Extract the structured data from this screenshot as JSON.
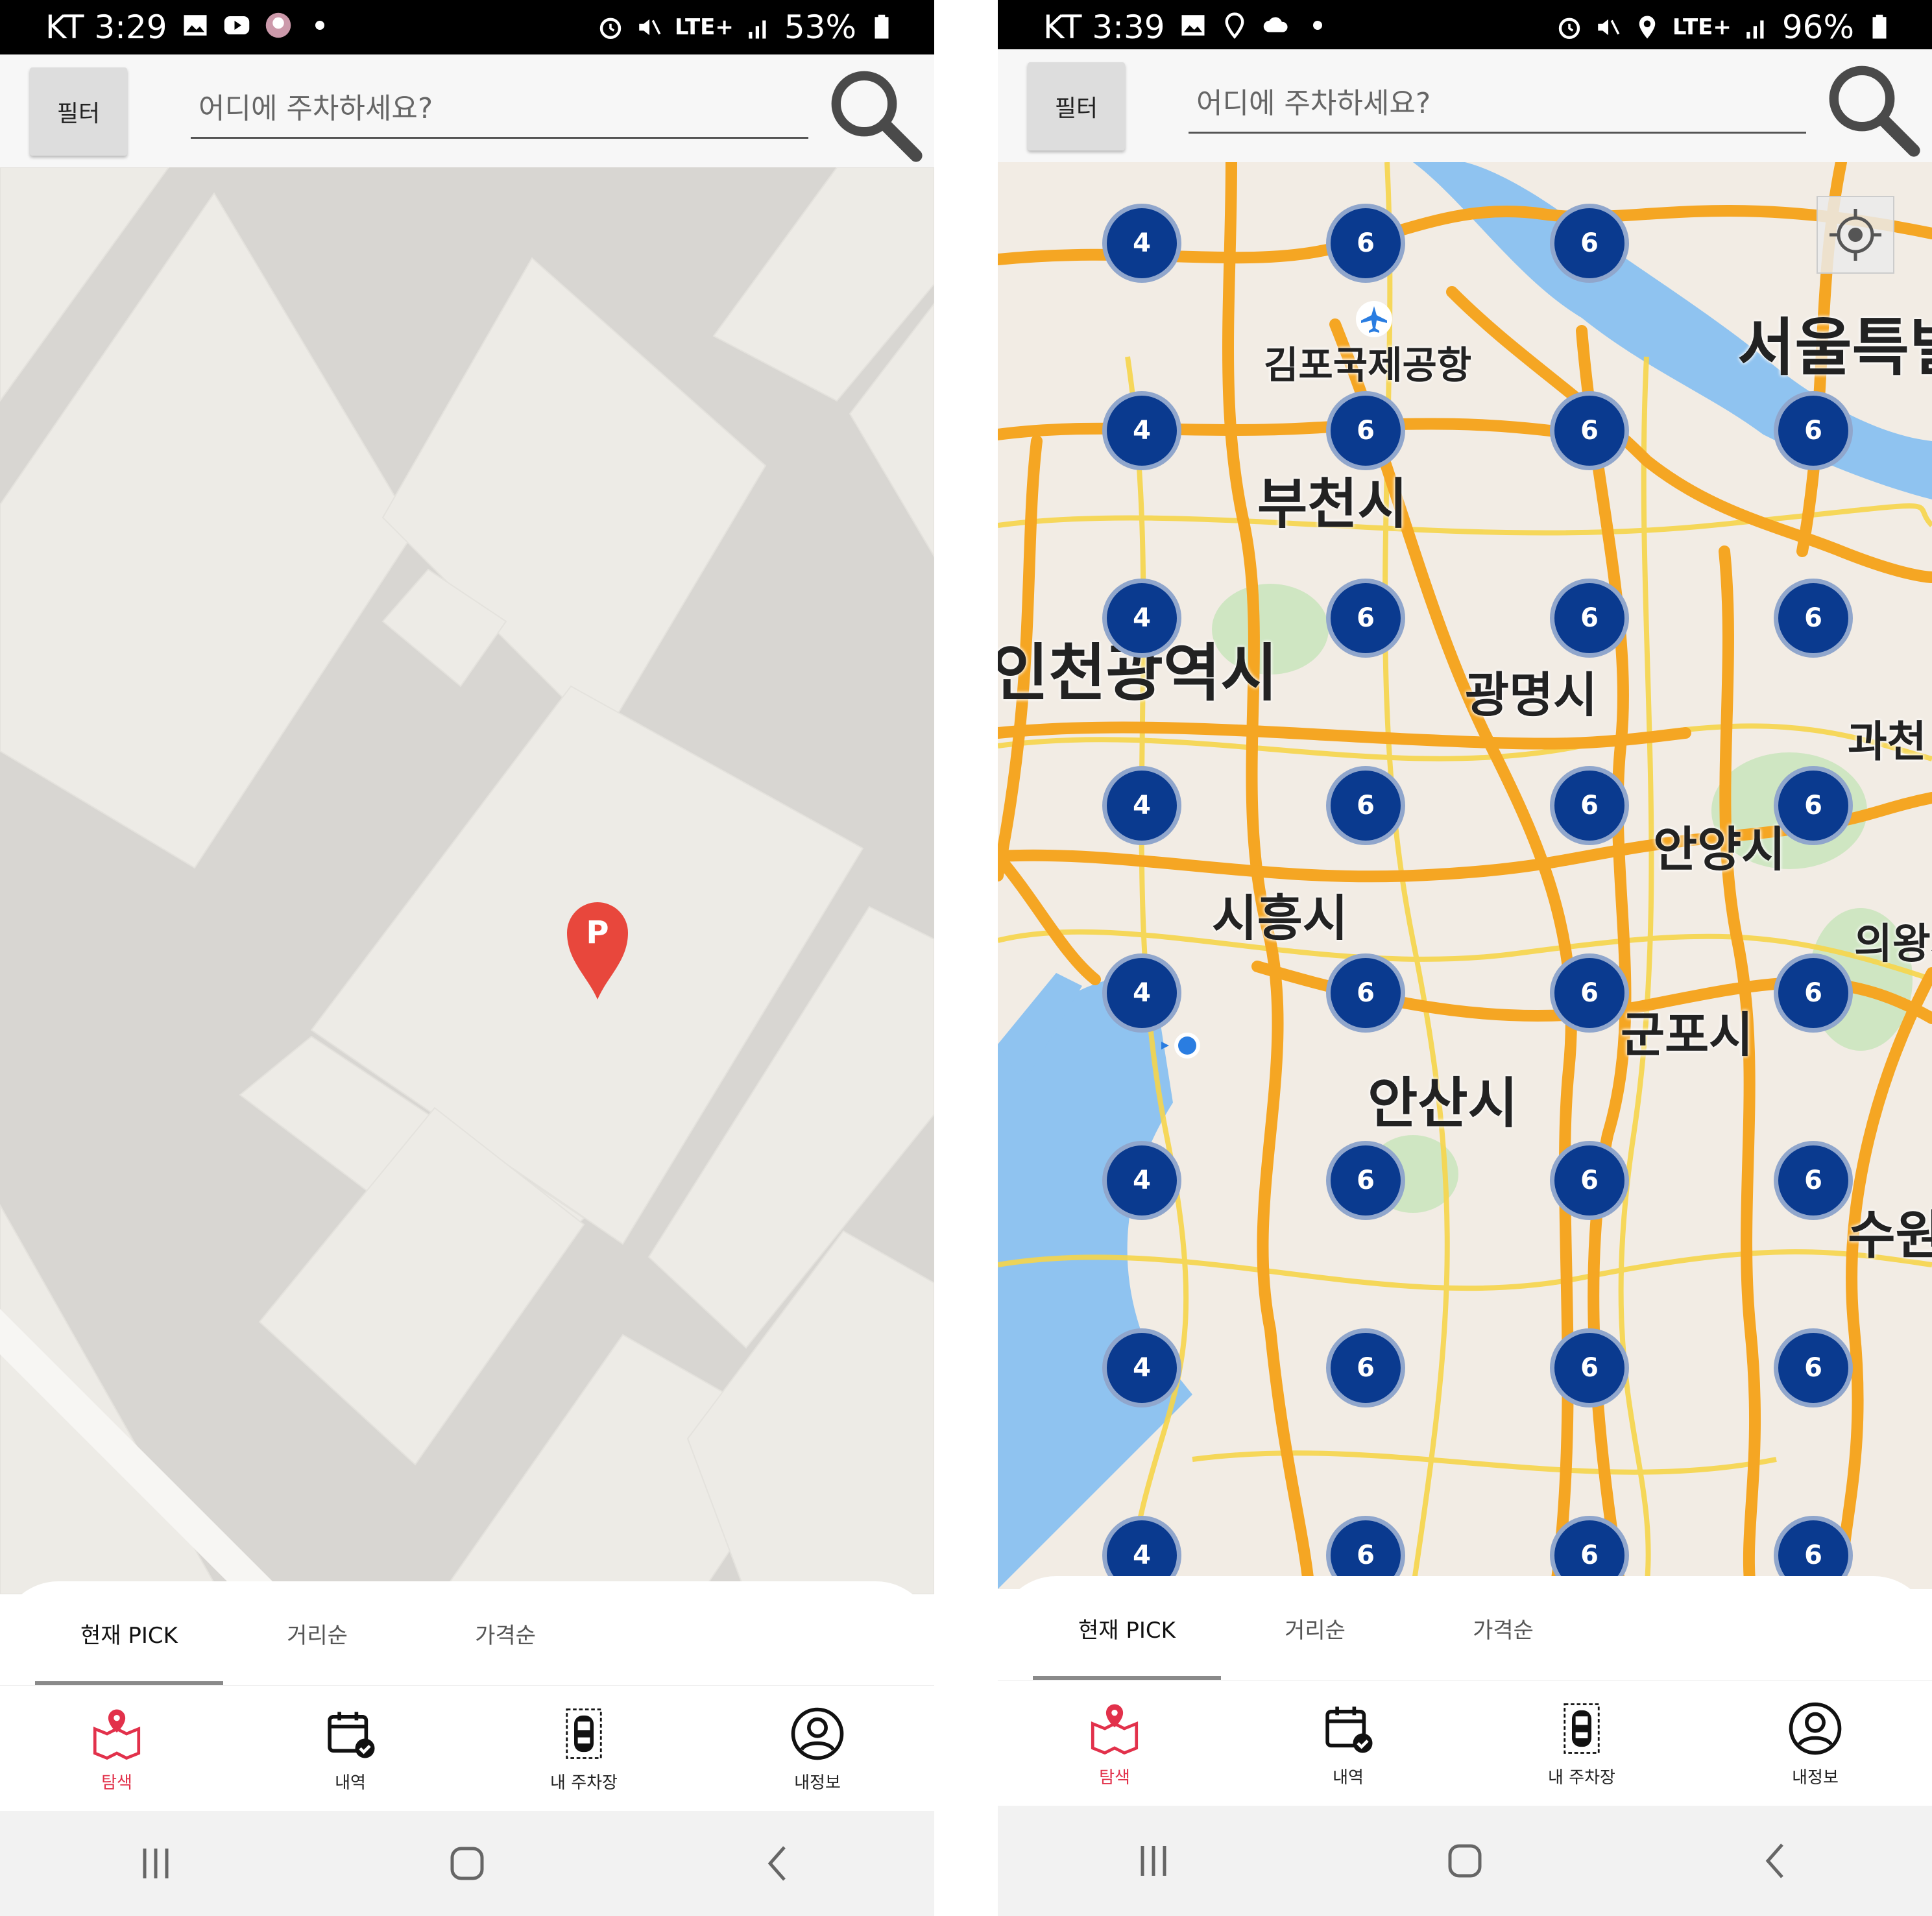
{
  "left": {
    "status": {
      "carrier_time": "KT 3:29",
      "battery": "53%",
      "network": "LTE+",
      "icons": [
        "gallery-icon",
        "youtube-icon",
        "avatar-icon",
        "dot-icon",
        "alarm-icon",
        "mute-icon",
        "hd-icon",
        "lte-icon",
        "signal-icon",
        "battery-icon"
      ]
    },
    "header": {
      "filter_label": "필터",
      "search_placeholder": "어디에 주차하세요?",
      "search_icon": "search-icon"
    },
    "map": {
      "marker_letter": "P",
      "marker_color": "#e8473c"
    },
    "tabs": [
      {
        "label": "현재 PICK",
        "active": true
      },
      {
        "label": "거리순",
        "active": false
      },
      {
        "label": "가격순",
        "active": false
      }
    ],
    "nav": [
      {
        "label": "탐색",
        "icon": "map-pin-icon",
        "active": true
      },
      {
        "label": "내역",
        "icon": "calendar-check-icon",
        "active": false
      },
      {
        "label": "내 주차장",
        "icon": "car-icon",
        "active": false
      },
      {
        "label": "내정보",
        "icon": "user-icon",
        "active": false
      }
    ]
  },
  "right": {
    "status": {
      "carrier_time": "KT 3:39",
      "battery": "96%",
      "network": "LTE+",
      "icons": [
        "gallery-icon",
        "location-icon",
        "cloud-icon",
        "dot-icon",
        "alarm-icon",
        "mute-icon",
        "location-icon",
        "hd-icon",
        "lte-icon",
        "signal-icon",
        "battery-icon"
      ]
    },
    "header": {
      "filter_label": "필터",
      "search_placeholder": "어디에 주차하세요?",
      "search_icon": "search-icon"
    },
    "map": {
      "places": {
        "airport": "김포국제공항",
        "seoul": "서울특별",
        "bucheon": "부천시",
        "incheon": "인천광역시",
        "gwangmyeong": "광명시",
        "gwacheon": "과천",
        "anyang": "안양시",
        "siheung": "시흥시",
        "uiwang": "의왕시",
        "gunpo": "군포시",
        "ansan": "안산시",
        "suwon": "수원"
      },
      "clusters": [
        [
          "4",
          "6",
          "6",
          ""
        ],
        [
          "4",
          "6",
          "6",
          "6"
        ],
        [
          "4",
          "6",
          "6",
          "6"
        ],
        [
          "4",
          "6",
          "6",
          "6"
        ],
        [
          "4",
          "6",
          "6",
          "6"
        ],
        [
          "4",
          "6",
          "6",
          "6"
        ],
        [
          "4",
          "6",
          "6",
          "6"
        ],
        [
          "4",
          "6",
          "6",
          "6"
        ]
      ],
      "cluster_color": "#0a3a8f"
    },
    "tabs": [
      {
        "label": "현재 PICK",
        "active": true
      },
      {
        "label": "거리순",
        "active": false
      },
      {
        "label": "가격순",
        "active": false
      }
    ],
    "nav": [
      {
        "label": "탐색",
        "icon": "map-pin-icon",
        "active": true
      },
      {
        "label": "내역",
        "icon": "calendar-check-icon",
        "active": false
      },
      {
        "label": "내 주차장",
        "icon": "car-icon",
        "active": false
      },
      {
        "label": "내정보",
        "icon": "user-icon",
        "active": false
      }
    ]
  },
  "colors": {
    "accent": "#e2314b",
    "highway": "#f5a623",
    "water": "#8fc3f0"
  }
}
